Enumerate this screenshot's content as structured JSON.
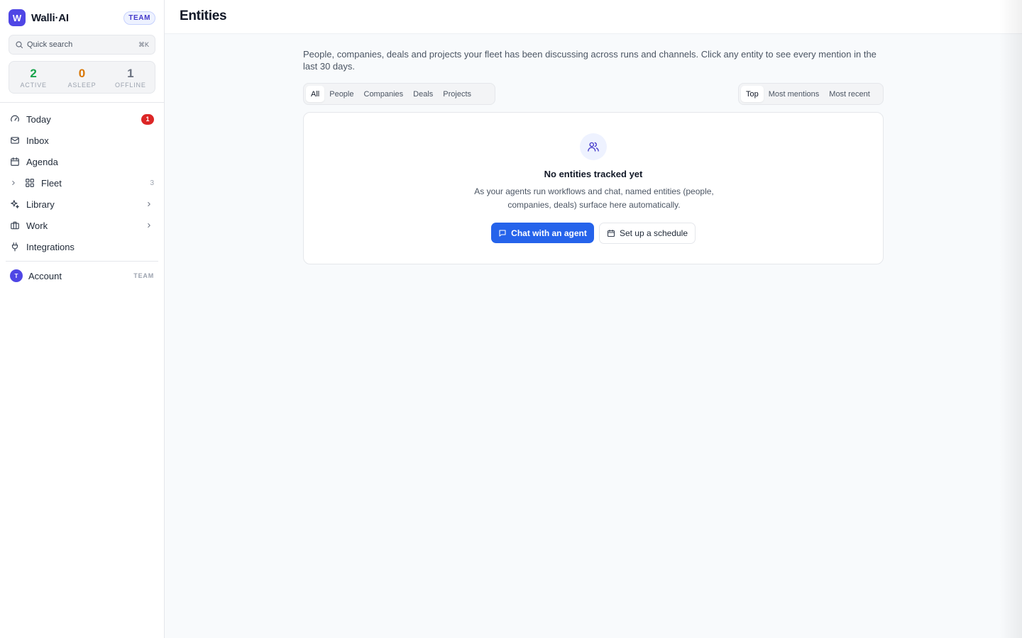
{
  "app": {
    "name": "Walli·AI",
    "logo_letter": "W",
    "plan_badge": "TEAM",
    "accent_color": "#4f46e5"
  },
  "search": {
    "placeholder": "Quick search",
    "shortcut": "⌘K",
    "icon": "search-icon"
  },
  "stats": [
    {
      "value": "2",
      "label": "ACTIVE",
      "color": "#16a34a"
    },
    {
      "value": "0",
      "label": "ASLEEP",
      "color": "#d97706"
    },
    {
      "value": "1",
      "label": "OFFLINE",
      "color": "#6b7280"
    }
  ],
  "nav": {
    "today": {
      "label": "Today",
      "badge": "1",
      "icon": "gauge-icon"
    },
    "inbox": {
      "label": "Inbox",
      "icon": "mail-icon"
    },
    "agenda": {
      "label": "Agenda",
      "icon": "calendar-icon"
    },
    "fleet": {
      "label": "Fleet",
      "count": "3",
      "icon": "grid-icon"
    },
    "library": {
      "label": "Library",
      "icon": "sparkles-icon"
    },
    "work": {
      "label": "Work",
      "icon": "briefcase-icon"
    },
    "integrations": {
      "label": "Integrations",
      "icon": "plug-icon"
    }
  },
  "account": {
    "label": "Account",
    "avatar_letter": "T",
    "tag": "TEAM"
  },
  "page": {
    "title": "Entities",
    "description": "People, companies, deals and projects your fleet has been discussing across runs and channels. Click any entity to see every mention in the last 30 days."
  },
  "filters": {
    "types": [
      "All",
      "People",
      "Companies",
      "Deals",
      "Projects"
    ],
    "active_type": "All",
    "sorts": [
      "Top",
      "Most mentions",
      "Most recent"
    ],
    "active_sort": "Top"
  },
  "empty_state": {
    "title": "No entities tracked yet",
    "description": "As your agents run workflows and chat, named entities (people, companies, deals) surface here automatically.",
    "primary_button": "Chat with an agent",
    "secondary_button": "Set up a schedule",
    "icon": "users-icon"
  }
}
